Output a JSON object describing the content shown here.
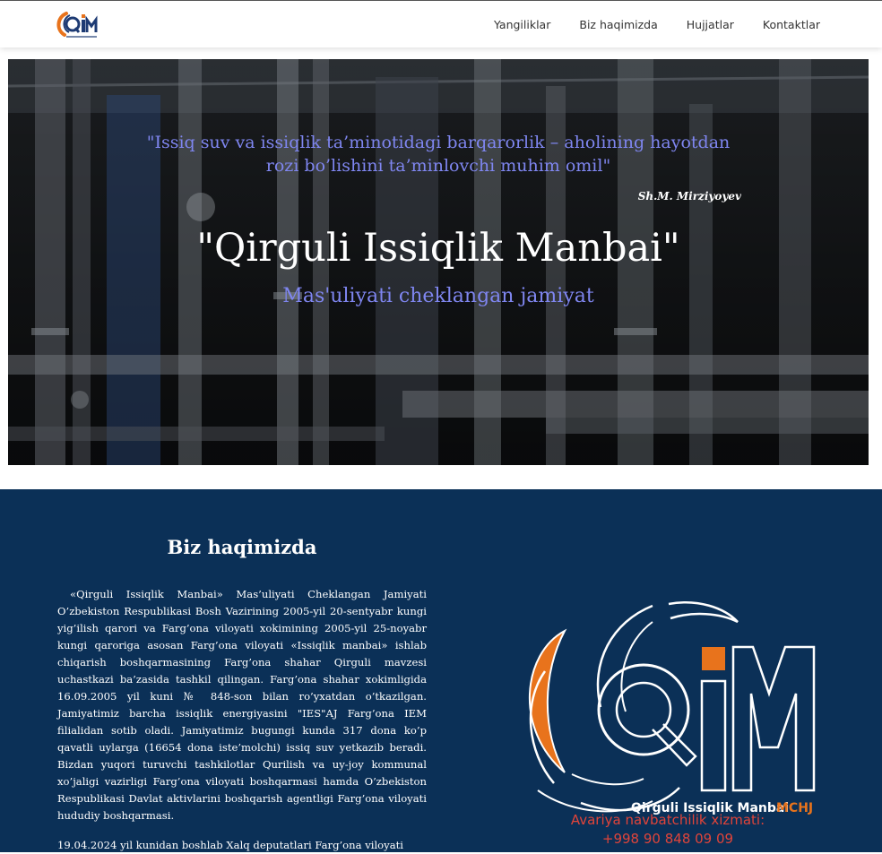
{
  "nav": {
    "items": [
      {
        "label": "Yangiliklar"
      },
      {
        "label": "Biz haqimizda"
      },
      {
        "label": "Hujjatlar"
      },
      {
        "label": "Kontaktlar"
      }
    ]
  },
  "hero": {
    "quote": "\"Issiq suv va issiqlik ta’minotidagi barqarorlik – aholining hayotdan rozi bo’lishini ta’minlovchi muhim omil\"",
    "quote_author": "Sh.M. Mirziyoyev",
    "title": "\"Qirguli Issiqlik Manbai\"",
    "subtitle": "Mas'uliyati cheklangan jamiyat"
  },
  "about": {
    "heading": "Biz haqimizda",
    "paragraph": "«Qirguli Issiqlik Manbai» Mas’uliyati Cheklangan Jamiyati O’zbekiston Respublikasi Bosh Vazirining 2005-yil 20-sentyabr kungi yig’ilish qarori va Farg’ona viloyati xokimining 2005-yil 25-noyabr kungi qaroriga asosan Farg’ona viloyati «Issiqlik manbai» ishlab chiqarish boshqarmasining Farg’ona shahar Qirguli mavzesi uchastkazi ba’zasida tashkil qilingan. Farg’ona shahar xokimligida 16.09.2005 yil kuni № 848-son bilan ro’yxatdan o’tkazilgan. Jamiyatimiz barcha issiqlik energiyasini \"IES\"AJ Farg’ona IEM filialidan sotib oladi. Jamiyatimiz bugungi kunda 317 dona ko’p qavatli uylarga (16654 dona iste’molchi) issiq suv yetkazib beradi. Bizdan yuqori turuvchi tashkilotlar Qurilish va uy-joy kommunal xo’jaligi vazirligi Farg’ona viloyati boshqarmasi hamda O’zbekiston Respublikasi Davlat aktivlarini boshqarish agentligi Farg’ona viloyati hududiy boshqarmasi.",
    "paragraph2": "19.04.2024 yil kunidan boshlab Xalq deputatlari Farg’ona viloyati",
    "logo_caption": "Qirguli Issiqlik Manbai",
    "logo_caption_suffix": "MCHJ",
    "emergency_label": "Avariya navbatchilik xizmati:",
    "emergency_phone": "+998 90 848 09 09"
  },
  "colors": {
    "accent_purple": "#7f86f0",
    "about_bg": "#0b3057",
    "logo_orange": "#e8731c",
    "logo_navy": "#1d3a73",
    "emergency_red": "#e0443a"
  }
}
